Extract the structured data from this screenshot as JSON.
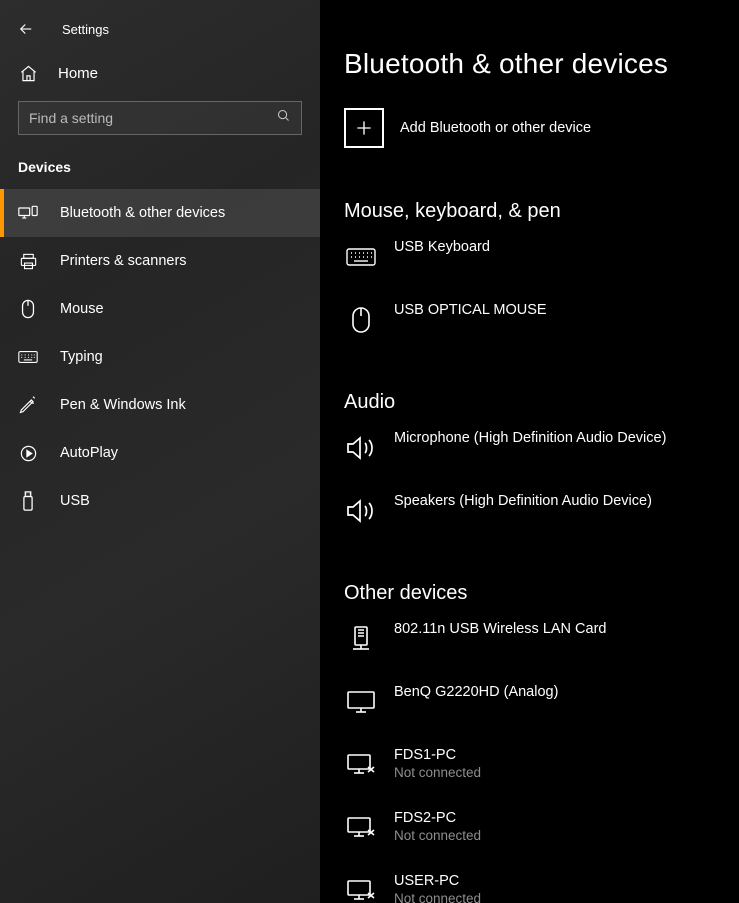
{
  "titlebar": {
    "title": "Settings",
    "home": "Home"
  },
  "search": {
    "placeholder": "Find a setting"
  },
  "category_header": "Devices",
  "nav": [
    {
      "label": "Bluetooth & other devices"
    },
    {
      "label": "Printers & scanners"
    },
    {
      "label": "Mouse"
    },
    {
      "label": "Typing"
    },
    {
      "label": "Pen & Windows Ink"
    },
    {
      "label": "AutoPlay"
    },
    {
      "label": "USB"
    }
  ],
  "page": {
    "title": "Bluetooth & other devices",
    "add_label": "Add Bluetooth or other device"
  },
  "sections": {
    "mouse_kb": {
      "title": "Mouse, keyboard, & pen",
      "items": [
        {
          "name": "USB Keyboard"
        },
        {
          "name": "USB OPTICAL MOUSE"
        }
      ]
    },
    "audio": {
      "title": "Audio",
      "items": [
        {
          "name": "Microphone (High Definition Audio Device)"
        },
        {
          "name": "Speakers (High Definition Audio Device)"
        }
      ]
    },
    "other": {
      "title": "Other devices",
      "items": [
        {
          "name": "802.11n USB Wireless LAN Card"
        },
        {
          "name": "BenQ G2220HD (Analog)"
        },
        {
          "name": "FDS1-PC",
          "status": "Not connected"
        },
        {
          "name": "FDS2-PC",
          "status": "Not connected"
        },
        {
          "name": "USER-PC",
          "status": "Not connected"
        }
      ]
    }
  }
}
